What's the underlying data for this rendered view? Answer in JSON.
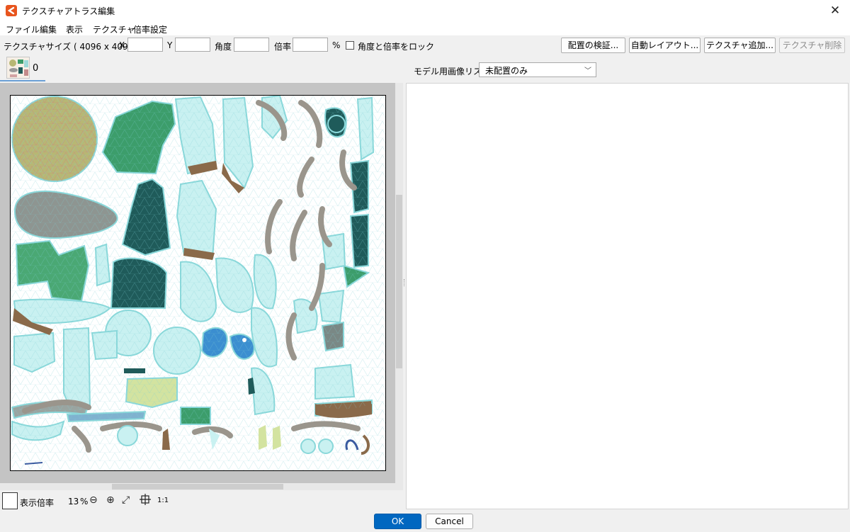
{
  "window": {
    "title": "テクスチャアトラス編集",
    "close_glyph": "✕"
  },
  "menu": [
    "ファイル",
    "編集",
    "表示",
    "テクスチャ",
    "倍率設定"
  ],
  "toolbar": {
    "texture_size_label": "テクスチャサイズ ( 4096 x 4096 )",
    "x_label": "X",
    "y_label": "Y",
    "angle_label": "角度",
    "scale_label": "倍率",
    "percent_label": "%",
    "lock_label": "角度と倍率をロック",
    "x_value": "",
    "y_value": "",
    "angle_value": "",
    "scale_value": "",
    "lock_checked": false,
    "buttons": {
      "verify": "配置の検証...",
      "auto_layout": "自動レイアウト...",
      "add_texture": "テクスチャ追加...",
      "delete_texture": "テクスチャ削除"
    }
  },
  "atlas_tabs": [
    {
      "label": "0",
      "selected": true
    }
  ],
  "model_image_list": {
    "label": "モデル用画像リスト",
    "selected": "未配置のみ"
  },
  "zoom": {
    "label": "表示倍率",
    "value": "13",
    "unit": "%",
    "zoom_out_glyph": "⊖",
    "zoom_in_glyph": "⊕",
    "fit_glyph": "⤢",
    "actual_glyph": "1:1"
  },
  "dialog": {
    "ok": "OK",
    "cancel": "Cancel"
  },
  "colors": {
    "accent": "#0067c0",
    "uv_fill": "#c9f1f1",
    "uv_outline": "#7fd6d9",
    "green": "#3c9d6b",
    "teal_dark": "#1f5b5a",
    "brown": "#8a6a4a",
    "khaki": "#b7b774"
  }
}
